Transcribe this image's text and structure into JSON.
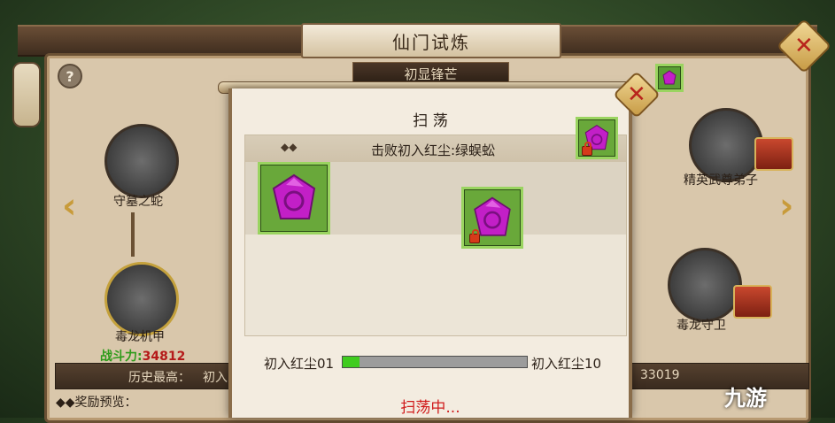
{
  "window": {
    "title": "仙门试炼",
    "subtitle": "初显锋芒",
    "help_glyph": "?"
  },
  "map": {
    "nodes": [
      {
        "label": "守墓之蛇"
      },
      {
        "label": "毒龙机甲",
        "power_label": "战斗力:",
        "power_value": "34812"
      },
      {
        "label": "精英武尊弟子"
      },
      {
        "label": "毒龙守卫"
      }
    ],
    "left_arrow": "‹",
    "right_arrow": "›"
  },
  "history": {
    "label": "历史最高：",
    "value_prefix": "初入",
    "right_value": "33019"
  },
  "reward_preview": {
    "label": "◆◆奖励预览："
  },
  "sweep_dialog": {
    "title": "扫 荡",
    "header_marker": "◆◆",
    "header_text": "击败初入红尘:绿蜈蚣",
    "progress": {
      "start_label": "初入红尘01",
      "end_label": "初入红尘10",
      "fraction": 0.09
    },
    "status": "扫荡中..."
  },
  "watermark": "九游",
  "colors": {
    "accent_red": "#d01c1c",
    "progress_green": "#3fcc1f",
    "power_green": "#2e9b1a",
    "power_red": "#b51a1a",
    "gem_magenta": "#c21fc7"
  }
}
